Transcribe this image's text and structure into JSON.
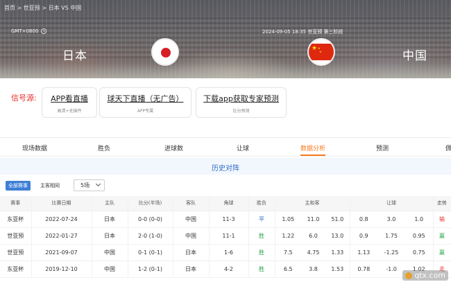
{
  "breadcrumb": {
    "home": "首页",
    "sep1": " > ",
    "league": "世亚预",
    "sep2": " > ",
    "match": "日本 VS 中国"
  },
  "header": {
    "timezone": "GMT+0800",
    "datetime": "2024-09-05 18:35",
    "competition": "世亚预 第三阶段",
    "home_team": "日本",
    "away_team": "中国"
  },
  "sources": {
    "label": "信号源:",
    "items": [
      {
        "title": "APP看直播",
        "sub": "高清+无插件"
      },
      {
        "title": "球天下直播（无广告）",
        "sub": "APP专属"
      },
      {
        "title": "下载app获取专家预测",
        "sub": "比分预测"
      }
    ]
  },
  "tabs": [
    "现场数据",
    "胜负",
    "进球数",
    "让球",
    "数据分析",
    "预测",
    "佩"
  ],
  "active_tab": "数据分析",
  "section": {
    "title": "历史对阵"
  },
  "filters": {
    "all_label": "全部赛事",
    "same_label": "主客相同",
    "count_value": "5场"
  },
  "table": {
    "headers": [
      "赛事",
      "比赛日期",
      "主队",
      "比分(半场)",
      "客队",
      "角球",
      "胜负",
      "主和客",
      "",
      "",
      "让球",
      "",
      "",
      "走势"
    ],
    "rows": [
      {
        "event": "东亚杯",
        "date": "2022-07-24",
        "home": "日本",
        "score": "0-0 (0-0)",
        "away": "中国",
        "corner": "11-3",
        "result": "平",
        "o1": "1.05",
        "o2": "11.0",
        "o3": "51.0",
        "h1": "0.8",
        "h2": "3.0",
        "h3": "1.0",
        "trend": "输"
      },
      {
        "event": "世亚预",
        "date": "2022-01-27",
        "home": "日本",
        "score": "2-0 (1-0)",
        "away": "中国",
        "corner": "11-1",
        "result": "胜",
        "o1": "1.22",
        "o2": "6.0",
        "o3": "13.0",
        "h1": "0.9",
        "h2": "1.75",
        "h3": "0.95",
        "trend": "赢"
      },
      {
        "event": "世亚预",
        "date": "2021-09-07",
        "home": "中国",
        "score": "0-1 (0-1)",
        "away": "日本",
        "corner": "1-6",
        "result": "胜",
        "o1": "7.5",
        "o2": "4.75",
        "o3": "1.33",
        "h1": "1.13",
        "h2": "-1.25",
        "h3": "0.75",
        "trend": "赢"
      },
      {
        "event": "东亚杯",
        "date": "2019-12-10",
        "home": "中国",
        "score": "1-2 (0-1)",
        "away": "日本",
        "corner": "4-2",
        "result": "胜",
        "o1": "6.5",
        "o2": "3.8",
        "o3": "1.53",
        "h1": "0.78",
        "h2": "-1.0",
        "h3": "1.02",
        "trend": "走"
      }
    ]
  },
  "watermark": "qtx.com",
  "colors": {
    "accent": "#f47b20",
    "link_blue": "#2e6bc6",
    "win": "#2aa44a",
    "lose": "#e5322d"
  }
}
